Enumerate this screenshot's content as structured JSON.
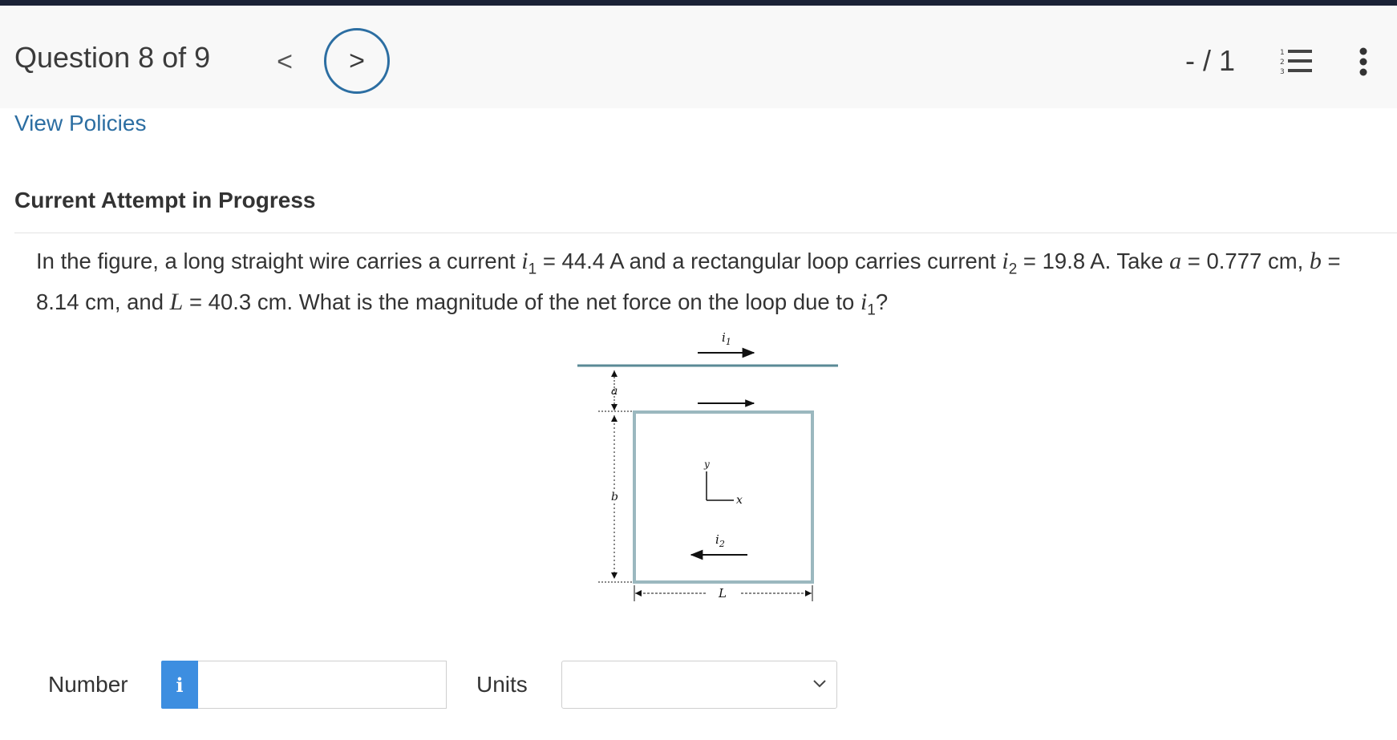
{
  "header": {
    "question_label": "Question 8 of 9",
    "prev_glyph": "<",
    "next_glyph": ">",
    "score": "- / 1",
    "icons": [
      "chevron-left-icon",
      "chevron-right-icon",
      "numbered-list-icon",
      "more-vertical-icon"
    ]
  },
  "links": {
    "view_policies": "View Policies"
  },
  "attempt": {
    "status": "Current Attempt in Progress"
  },
  "question": {
    "t1": "In the figure, a long straight wire carries a current ",
    "i1_var": "i",
    "i1_sub": "1",
    "t2": " = 44.4 A and a rectangular loop carries current ",
    "i2_var": "i",
    "i2_sub": "2",
    "t3": " = 19.8 A. Take ",
    "a_var": "a",
    "t4": " = 0.777 cm, ",
    "b_var": "b",
    "t5": " = 8.14 cm, and ",
    "L_var": "L",
    "t6": " = 40.3 cm. What is the magnitude of the net force on the loop due to ",
    "i1b_var": "i",
    "i1b_sub": "1",
    "t7": "?"
  },
  "figure": {
    "i1_label": "i",
    "i1_sub": "1",
    "i2_label": "i",
    "i2_sub": "2",
    "a_label": "a",
    "b_label": "b",
    "L_label": "L",
    "x_label": "x",
    "y_label": "y",
    "colors": {
      "wire": "#5a8a96",
      "loop": "#9bb8bf",
      "ink": "#111111"
    }
  },
  "answer": {
    "number_label": "Number",
    "info_glyph": "i",
    "number_value": "",
    "units_label": "Units",
    "units_value": ""
  },
  "colors": {
    "accent": "#2c6ea2",
    "info_button": "#3d8ee0",
    "topbar": "#1b2236",
    "header_bg": "#f8f8f8"
  }
}
